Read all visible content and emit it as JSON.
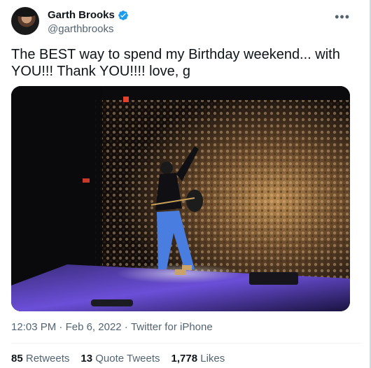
{
  "author": {
    "display_name": "Garth Brooks",
    "handle": "@garthbrooks",
    "verified": true,
    "more_icon": "more-horizontal-icon"
  },
  "tweet": {
    "text": "The BEST way to spend my Birthday weekend... with YOU!!! Thank YOU!!!! love, g",
    "time": "12:03 PM",
    "date": "Feb 6, 2022",
    "source": "Twitter for iPhone",
    "separator": " · "
  },
  "stats": {
    "retweets_count": "85",
    "retweets_label": "Retweets",
    "quotes_count": "13",
    "quotes_label": "Quote Tweets",
    "likes_count": "1,778",
    "likes_label": "Likes"
  },
  "colors": {
    "verified_blue": "#1d9bf0",
    "secondary_text": "#536471",
    "stage_purple": "#6b4fd8"
  }
}
